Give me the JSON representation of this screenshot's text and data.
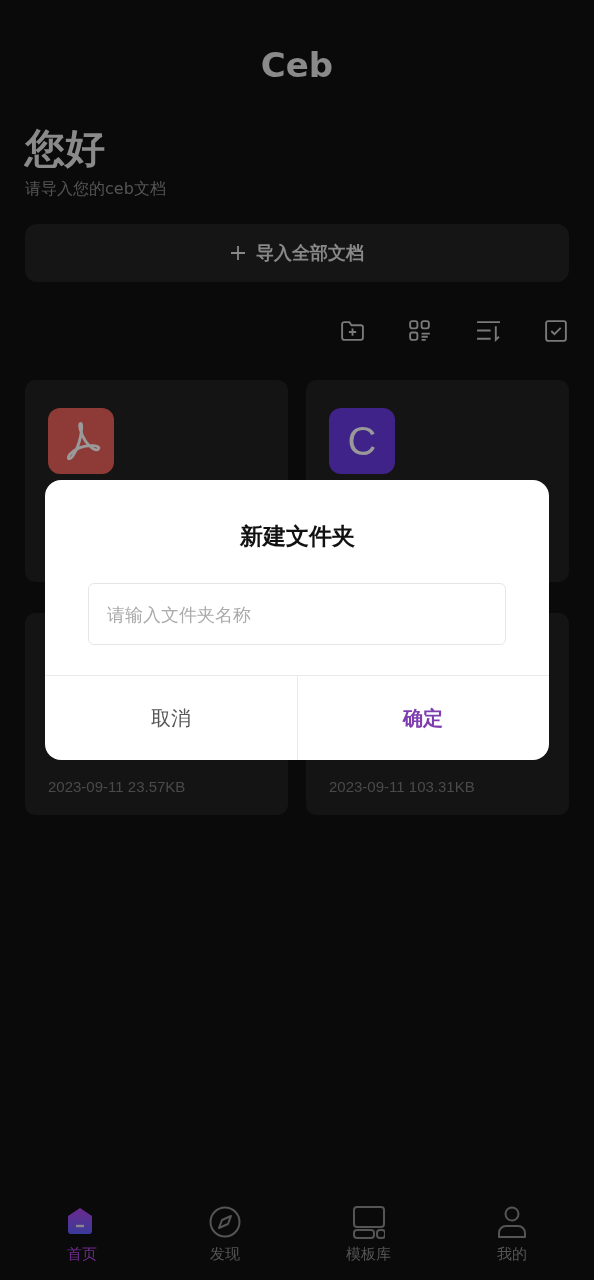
{
  "app_title": "Ceb",
  "greeting": "您好",
  "subtitle": "请导入您的ceb文档",
  "import_button": {
    "label": "导入全部文档"
  },
  "toolbar": [
    {
      "kind": "new-folder"
    },
    {
      "kind": "grid"
    },
    {
      "kind": "sort"
    },
    {
      "kind": "select"
    }
  ],
  "documents": [
    {
      "kind": "pdf"
    },
    {
      "kind": "letter",
      "letter": "C"
    },
    {
      "meta": "2023-09-11 23.57KB"
    },
    {
      "meta": "2023-09-11 103.31KB"
    }
  ],
  "dialog": {
    "title": "新建文件夹",
    "input": {
      "placeholder": "请输入文件夹名称"
    },
    "buttons": [
      {
        "label": "取消",
        "kind": "cancel"
      },
      {
        "label": "确定",
        "kind": "confirm"
      }
    ]
  },
  "nav": [
    {
      "label": "首页",
      "kind": "home",
      "selected": true
    },
    {
      "label": "发现",
      "kind": "compass",
      "selected": false
    },
    {
      "label": "模板库",
      "kind": "templates",
      "selected": false
    },
    {
      "label": "我的",
      "kind": "user",
      "selected": false
    }
  ]
}
